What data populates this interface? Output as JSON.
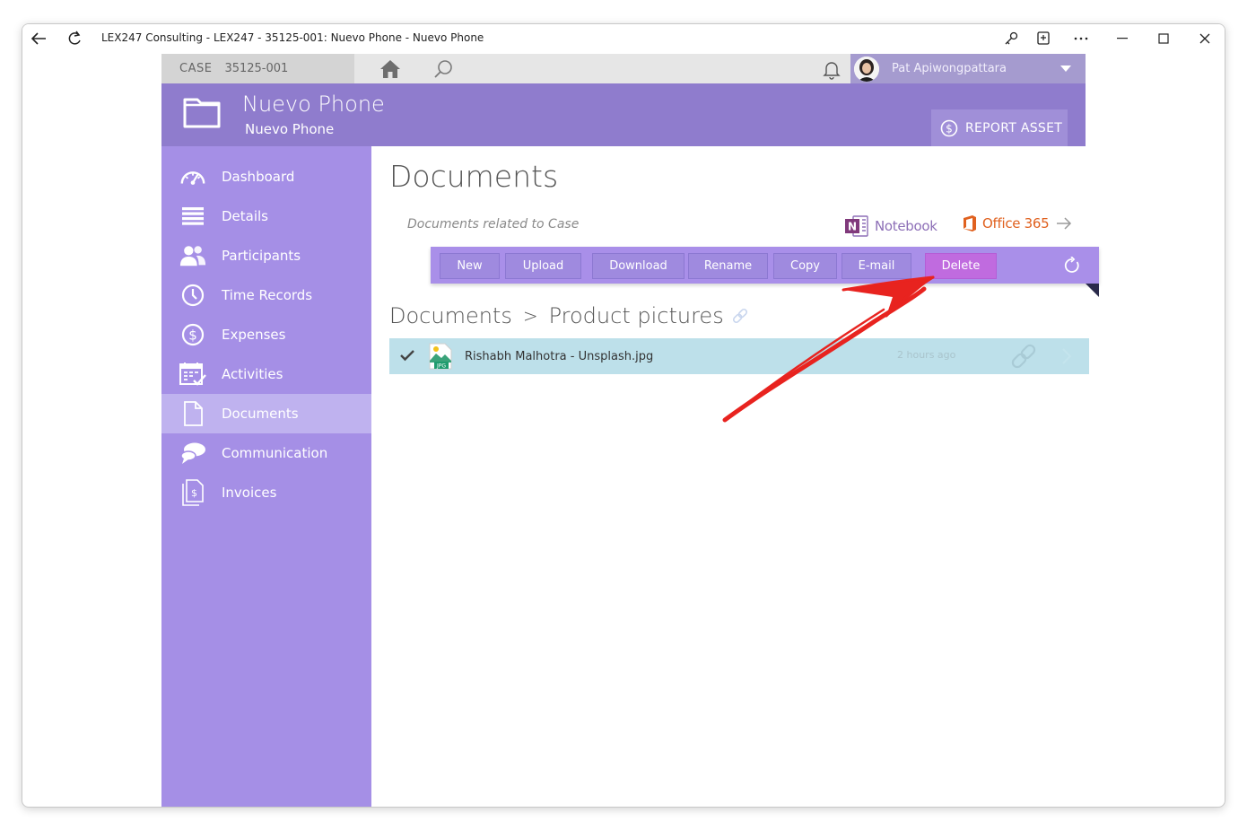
{
  "window": {
    "title": "LEX247 Consulting - LEX247 - 35125-001: Nuevo Phone - Nuevo Phone"
  },
  "topbar": {
    "case_label": "CASE",
    "case_number": "35125-001",
    "user_name": "Pat Apiwongpattara"
  },
  "header": {
    "title": "Nuevo Phone",
    "subtitle": "Nuevo Phone",
    "report_asset_label": "REPORT ASSET"
  },
  "sidebar": {
    "items": [
      {
        "label": "Dashboard",
        "icon": "gauge-icon"
      },
      {
        "label": "Details",
        "icon": "list-icon"
      },
      {
        "label": "Participants",
        "icon": "people-icon"
      },
      {
        "label": "Time Records",
        "icon": "clock-icon"
      },
      {
        "label": "Expenses",
        "icon": "dollar-circle-icon"
      },
      {
        "label": "Activities",
        "icon": "calendar-check-icon"
      },
      {
        "label": "Documents",
        "icon": "document-icon",
        "active": true
      },
      {
        "label": "Communication",
        "icon": "chat-icon"
      },
      {
        "label": "Invoices",
        "icon": "invoice-icon"
      }
    ]
  },
  "main": {
    "title": "Documents",
    "related_text": "Documents related to Case",
    "notebook_label": "Notebook",
    "office_label": "Office 365",
    "toolbar": {
      "buttons": [
        "New",
        "Upload",
        "Download",
        "Rename",
        "Copy",
        "E-mail",
        "Delete"
      ]
    },
    "breadcrumb": {
      "root": "Documents",
      "separator": ">",
      "current": "Product pictures"
    },
    "files": [
      {
        "name": "Rishabh Malhotra - Unsplash.jpg",
        "time": "2 hours ago",
        "type": "JPG"
      }
    ]
  },
  "colors": {
    "header": "#8f7ccd",
    "sidebar": "#a58fe6",
    "sidebar_active": "#bfb2ef",
    "toolbar": "#a98fe9",
    "delete_button": "#c06bdf",
    "selected_row": "#bde0ea",
    "annotation_arrow": "#e8231f"
  }
}
